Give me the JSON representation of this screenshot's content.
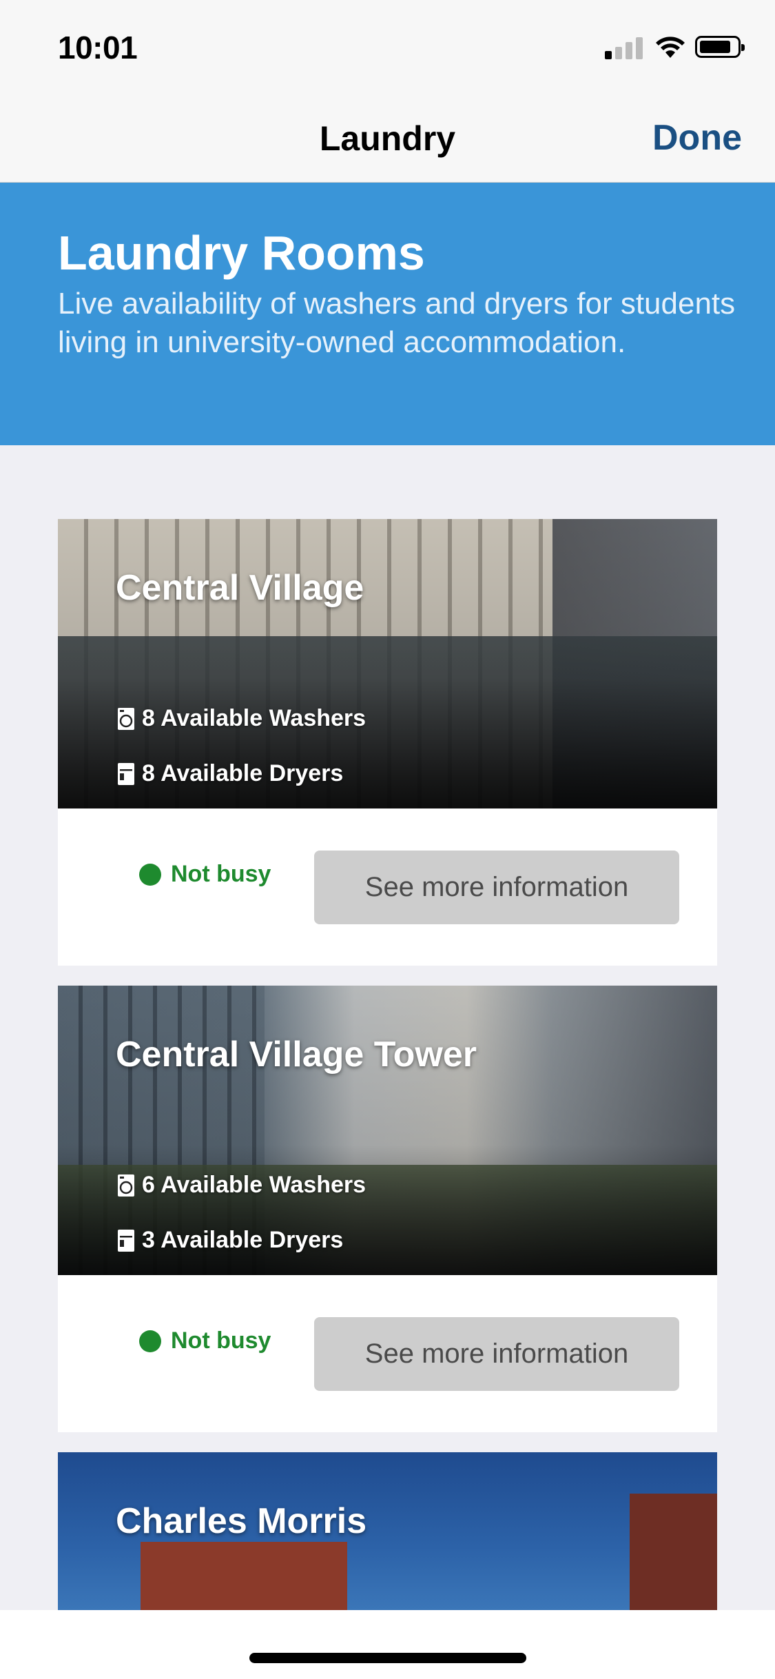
{
  "status": {
    "time": "10:01"
  },
  "nav": {
    "title": "Laundry",
    "done_label": "Done"
  },
  "banner": {
    "title": "Laundry Rooms",
    "subtitle": "Live availability of washers and dryers for students living in university-owned accommodation."
  },
  "cards": [
    {
      "name": "Central Village",
      "washers": "8 Available Washers",
      "dryers": "8 Available Dryers",
      "status": "Not busy",
      "button": "See more information"
    },
    {
      "name": "Central Village Tower",
      "washers": "6 Available Washers",
      "dryers": "3 Available Dryers",
      "status": "Not busy",
      "button": "See more information"
    },
    {
      "name": "Charles Morris"
    }
  ],
  "colors": {
    "accent": "#3a95d8",
    "done": "#1a4f82",
    "status_ok": "#1e8a2e"
  },
  "icons": {
    "washer": "washer-icon",
    "dryer": "dryer-icon",
    "status": "status-dot-icon"
  }
}
